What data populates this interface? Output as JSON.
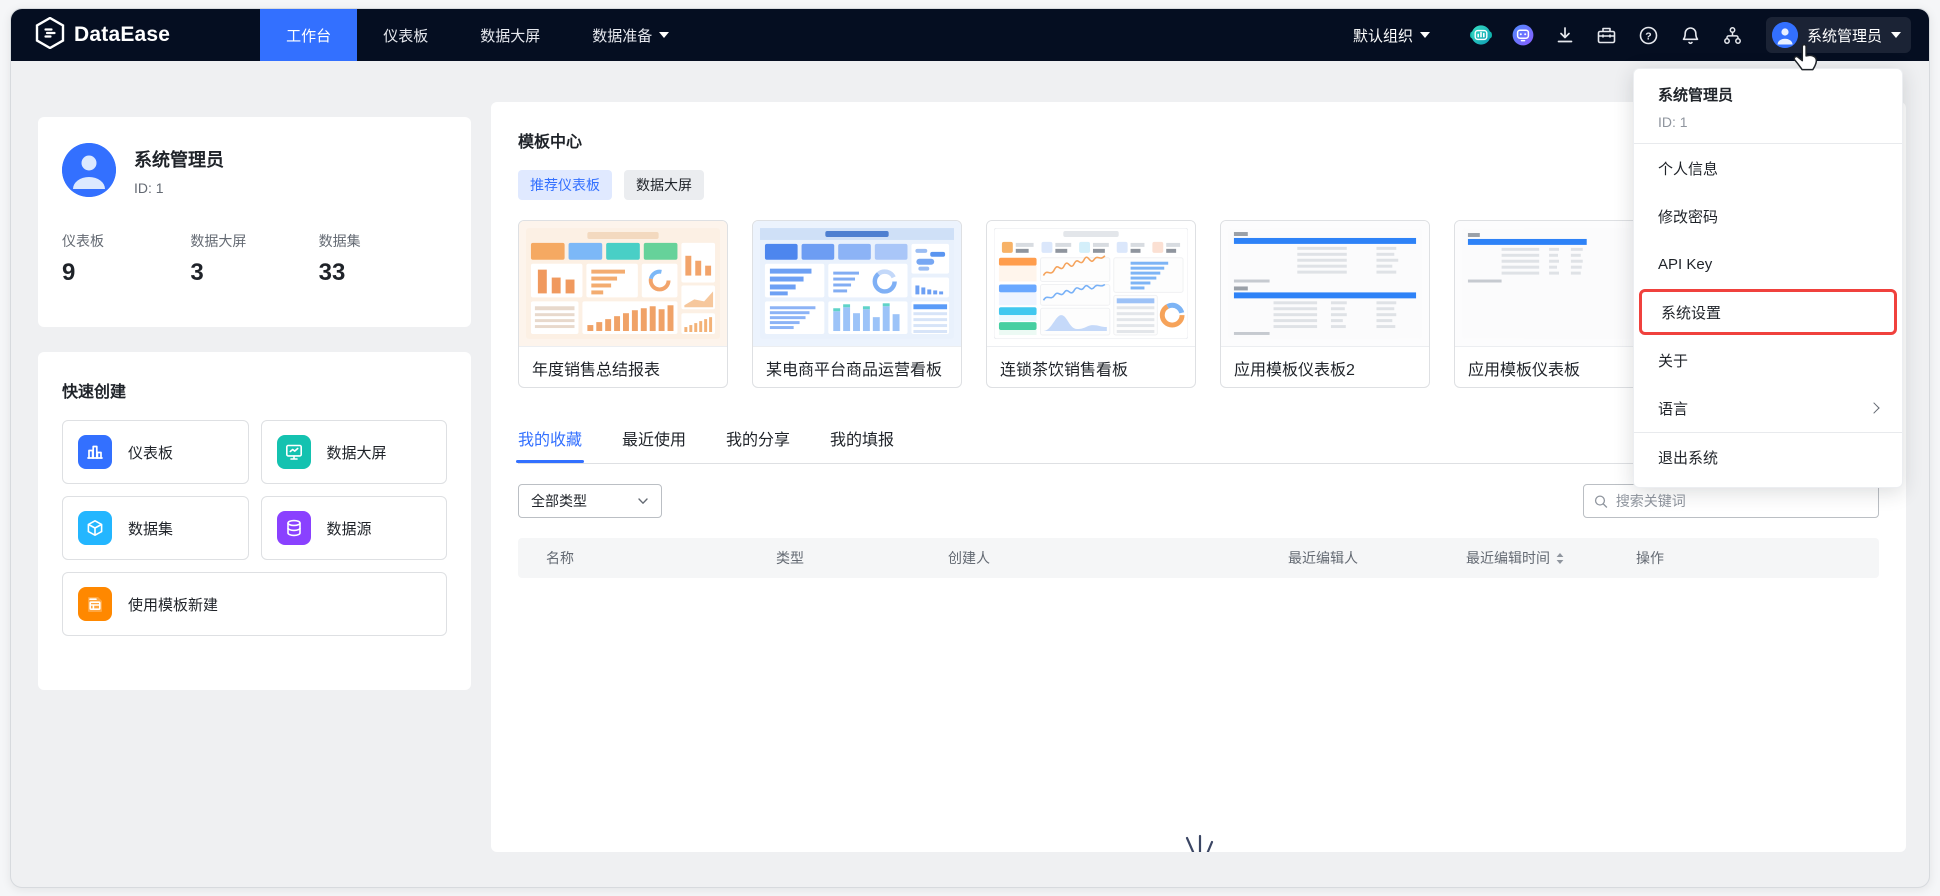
{
  "nav": {
    "brand": "DataEase",
    "tabs": [
      "工作台",
      "仪表板",
      "数据大屏",
      "数据准备"
    ],
    "active_tab": "工作台",
    "org": "默认组织",
    "user": "系统管理员",
    "icons": [
      "copilot-robot-icon",
      "ai-assistant-icon",
      "download-icon",
      "toolbox-icon",
      "help-icon",
      "bell-icon",
      "org-tree-icon"
    ]
  },
  "profile": {
    "name": "系统管理员",
    "id": "ID: 1",
    "stats": [
      {
        "label": "仪表板",
        "value": "9"
      },
      {
        "label": "数据大屏",
        "value": "3"
      },
      {
        "label": "数据集",
        "value": "33"
      }
    ]
  },
  "quick_create": {
    "title": "快速创建",
    "items": [
      {
        "label": "仪表板",
        "icon": "bar-chart-icon",
        "color": "#3370ff"
      },
      {
        "label": "数据大屏",
        "icon": "screen-icon",
        "color": "#14c2b0"
      },
      {
        "label": "数据集",
        "icon": "cube-icon",
        "color": "#23b6ff"
      },
      {
        "label": "数据源",
        "icon": "database-icon",
        "color": "#8a41ff"
      },
      {
        "label": "使用模板新建",
        "icon": "template-icon",
        "color": "#ff8800"
      }
    ]
  },
  "template_center": {
    "title": "模板中心",
    "tags": [
      {
        "label": "推荐仪表板",
        "active": true
      },
      {
        "label": "数据大屏",
        "active": false
      }
    ],
    "cards": [
      {
        "title": "年度销售总结报表"
      },
      {
        "title": "某电商平台商品运营看板"
      },
      {
        "title": "连锁茶饮销售看板"
      },
      {
        "title": "应用模板仪表板2"
      },
      {
        "title": "应用模板仪表板"
      }
    ]
  },
  "workspace": {
    "tabs": [
      {
        "label": "我的收藏",
        "active": true
      },
      {
        "label": "最近使用",
        "active": false
      },
      {
        "label": "我的分享",
        "active": false
      },
      {
        "label": "我的填报",
        "active": false
      }
    ],
    "type_filter": "全部类型",
    "search_placeholder": "搜索关键词",
    "table_headers": [
      "名称",
      "类型",
      "创建人",
      "最近编辑人",
      "最近编辑时间",
      "操作"
    ],
    "sorted_column": "最近编辑时间"
  },
  "user_menu": {
    "name": "系统管理员",
    "id": "ID: 1",
    "items": [
      "个人信息",
      "修改密码",
      "API Key",
      "系统设置",
      "关于",
      "语言",
      "退出系统"
    ],
    "highlighted_item": "系统设置"
  },
  "colors": {
    "accent": "#3370ff",
    "navbar_bg": "#050e21",
    "highlight_red": "#f0413d",
    "page_bg": "#eff0f2",
    "teal": "#14c2b0",
    "cyan": "#23b6ff",
    "purple": "#8a41ff",
    "orange": "#ff8800"
  }
}
